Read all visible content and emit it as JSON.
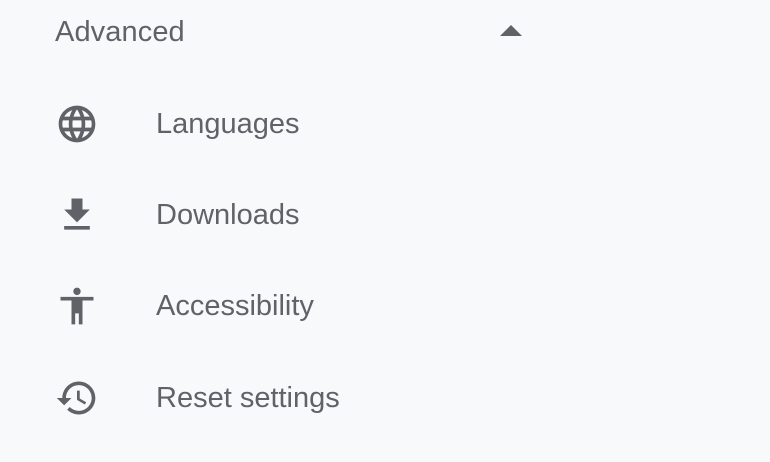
{
  "advanced": {
    "title": "Advanced",
    "expanded": true,
    "icon": "arrow-drop-up-icon"
  },
  "items": [
    {
      "label": "Languages",
      "icon": "globe-icon"
    },
    {
      "label": "Downloads",
      "icon": "download-icon"
    },
    {
      "label": "Accessibility",
      "icon": "accessibility-icon"
    },
    {
      "label": "Reset settings",
      "icon": "restore-icon"
    }
  ],
  "colors": {
    "background": "#f8f9fa",
    "text": "#5f6368",
    "icon": "#5f6368"
  }
}
